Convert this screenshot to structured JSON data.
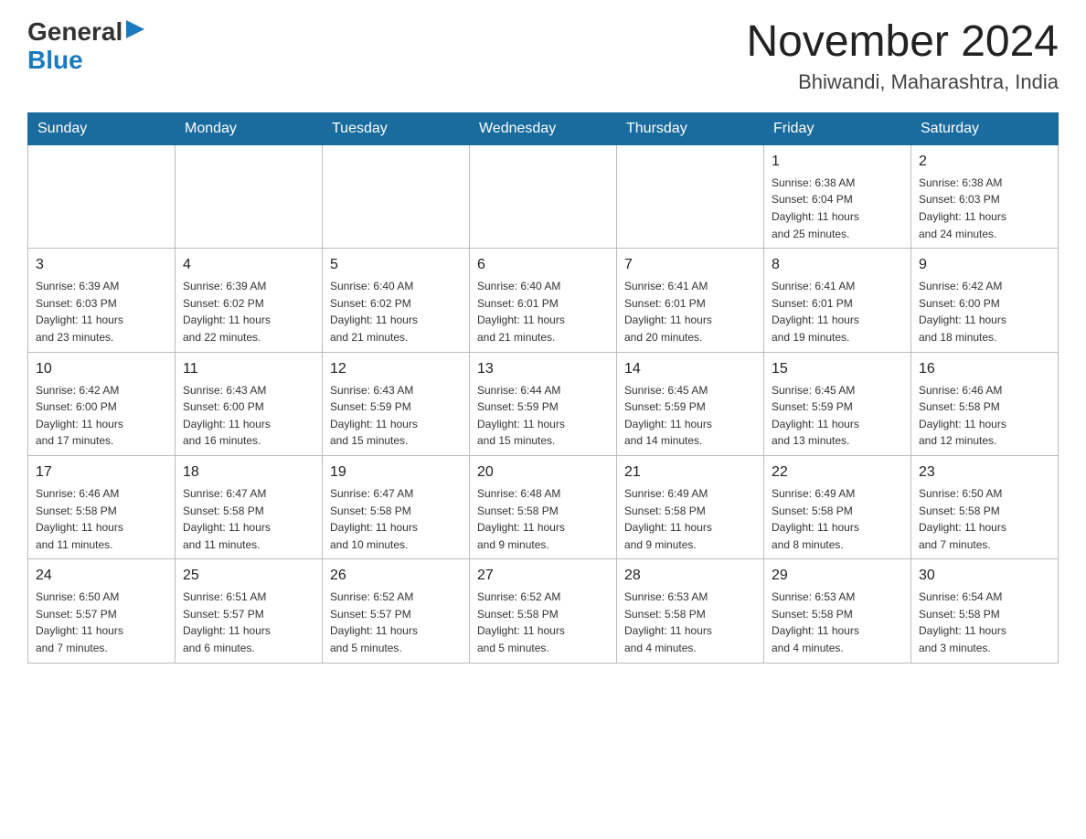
{
  "header": {
    "logo_general": "General",
    "logo_blue": "Blue",
    "month_title": "November 2024",
    "location": "Bhiwandi, Maharashtra, India"
  },
  "days_of_week": [
    "Sunday",
    "Monday",
    "Tuesday",
    "Wednesday",
    "Thursday",
    "Friday",
    "Saturday"
  ],
  "weeks": [
    [
      {
        "day": "",
        "info": ""
      },
      {
        "day": "",
        "info": ""
      },
      {
        "day": "",
        "info": ""
      },
      {
        "day": "",
        "info": ""
      },
      {
        "day": "",
        "info": ""
      },
      {
        "day": "1",
        "info": "Sunrise: 6:38 AM\nSunset: 6:04 PM\nDaylight: 11 hours\nand 25 minutes."
      },
      {
        "day": "2",
        "info": "Sunrise: 6:38 AM\nSunset: 6:03 PM\nDaylight: 11 hours\nand 24 minutes."
      }
    ],
    [
      {
        "day": "3",
        "info": "Sunrise: 6:39 AM\nSunset: 6:03 PM\nDaylight: 11 hours\nand 23 minutes."
      },
      {
        "day": "4",
        "info": "Sunrise: 6:39 AM\nSunset: 6:02 PM\nDaylight: 11 hours\nand 22 minutes."
      },
      {
        "day": "5",
        "info": "Sunrise: 6:40 AM\nSunset: 6:02 PM\nDaylight: 11 hours\nand 21 minutes."
      },
      {
        "day": "6",
        "info": "Sunrise: 6:40 AM\nSunset: 6:01 PM\nDaylight: 11 hours\nand 21 minutes."
      },
      {
        "day": "7",
        "info": "Sunrise: 6:41 AM\nSunset: 6:01 PM\nDaylight: 11 hours\nand 20 minutes."
      },
      {
        "day": "8",
        "info": "Sunrise: 6:41 AM\nSunset: 6:01 PM\nDaylight: 11 hours\nand 19 minutes."
      },
      {
        "day": "9",
        "info": "Sunrise: 6:42 AM\nSunset: 6:00 PM\nDaylight: 11 hours\nand 18 minutes."
      }
    ],
    [
      {
        "day": "10",
        "info": "Sunrise: 6:42 AM\nSunset: 6:00 PM\nDaylight: 11 hours\nand 17 minutes."
      },
      {
        "day": "11",
        "info": "Sunrise: 6:43 AM\nSunset: 6:00 PM\nDaylight: 11 hours\nand 16 minutes."
      },
      {
        "day": "12",
        "info": "Sunrise: 6:43 AM\nSunset: 5:59 PM\nDaylight: 11 hours\nand 15 minutes."
      },
      {
        "day": "13",
        "info": "Sunrise: 6:44 AM\nSunset: 5:59 PM\nDaylight: 11 hours\nand 15 minutes."
      },
      {
        "day": "14",
        "info": "Sunrise: 6:45 AM\nSunset: 5:59 PM\nDaylight: 11 hours\nand 14 minutes."
      },
      {
        "day": "15",
        "info": "Sunrise: 6:45 AM\nSunset: 5:59 PM\nDaylight: 11 hours\nand 13 minutes."
      },
      {
        "day": "16",
        "info": "Sunrise: 6:46 AM\nSunset: 5:58 PM\nDaylight: 11 hours\nand 12 minutes."
      }
    ],
    [
      {
        "day": "17",
        "info": "Sunrise: 6:46 AM\nSunset: 5:58 PM\nDaylight: 11 hours\nand 11 minutes."
      },
      {
        "day": "18",
        "info": "Sunrise: 6:47 AM\nSunset: 5:58 PM\nDaylight: 11 hours\nand 11 minutes."
      },
      {
        "day": "19",
        "info": "Sunrise: 6:47 AM\nSunset: 5:58 PM\nDaylight: 11 hours\nand 10 minutes."
      },
      {
        "day": "20",
        "info": "Sunrise: 6:48 AM\nSunset: 5:58 PM\nDaylight: 11 hours\nand 9 minutes."
      },
      {
        "day": "21",
        "info": "Sunrise: 6:49 AM\nSunset: 5:58 PM\nDaylight: 11 hours\nand 9 minutes."
      },
      {
        "day": "22",
        "info": "Sunrise: 6:49 AM\nSunset: 5:58 PM\nDaylight: 11 hours\nand 8 minutes."
      },
      {
        "day": "23",
        "info": "Sunrise: 6:50 AM\nSunset: 5:58 PM\nDaylight: 11 hours\nand 7 minutes."
      }
    ],
    [
      {
        "day": "24",
        "info": "Sunrise: 6:50 AM\nSunset: 5:57 PM\nDaylight: 11 hours\nand 7 minutes."
      },
      {
        "day": "25",
        "info": "Sunrise: 6:51 AM\nSunset: 5:57 PM\nDaylight: 11 hours\nand 6 minutes."
      },
      {
        "day": "26",
        "info": "Sunrise: 6:52 AM\nSunset: 5:57 PM\nDaylight: 11 hours\nand 5 minutes."
      },
      {
        "day": "27",
        "info": "Sunrise: 6:52 AM\nSunset: 5:58 PM\nDaylight: 11 hours\nand 5 minutes."
      },
      {
        "day": "28",
        "info": "Sunrise: 6:53 AM\nSunset: 5:58 PM\nDaylight: 11 hours\nand 4 minutes."
      },
      {
        "day": "29",
        "info": "Sunrise: 6:53 AM\nSunset: 5:58 PM\nDaylight: 11 hours\nand 4 minutes."
      },
      {
        "day": "30",
        "info": "Sunrise: 6:54 AM\nSunset: 5:58 PM\nDaylight: 11 hours\nand 3 minutes."
      }
    ]
  ]
}
